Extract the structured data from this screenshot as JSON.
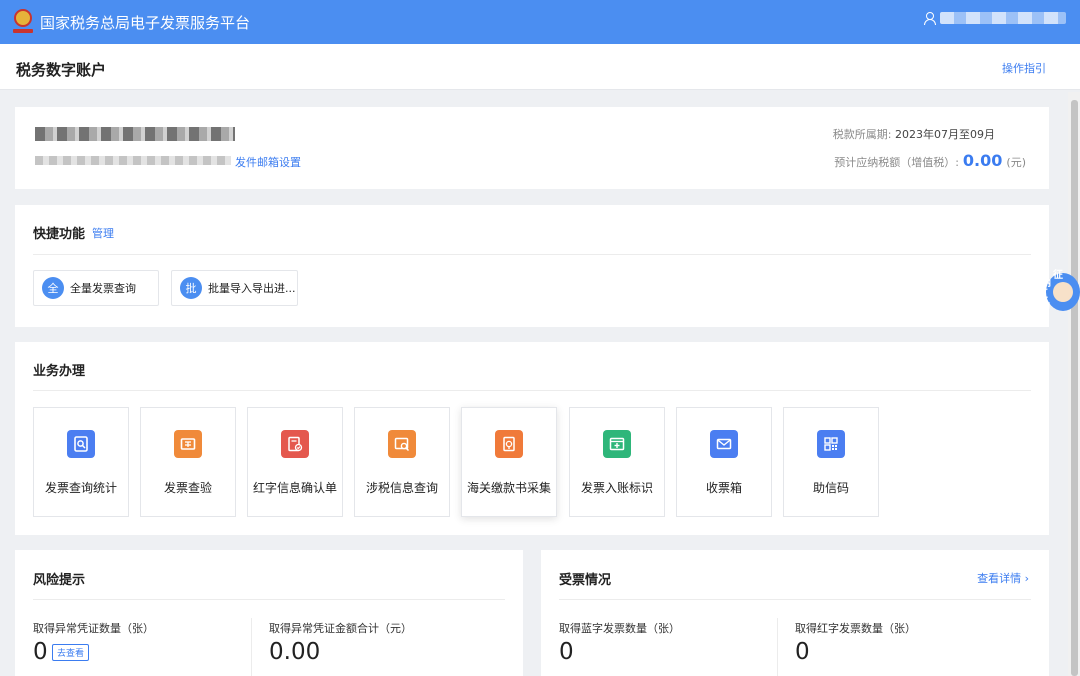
{
  "header": {
    "title": "国家税务总局电子发票服务平台"
  },
  "subheader": {
    "title": "税务数字账户",
    "help_link": "操作指引"
  },
  "account": {
    "email_settings": "发件邮箱设置",
    "period_label": "税款所属期:",
    "period_value": "2023年07月至09月",
    "tax_label": "预计应纳税额（增值税）:",
    "tax_amount": "0.00",
    "tax_unit": "(元)"
  },
  "quick": {
    "title": "快捷功能",
    "manage": "管理",
    "items": [
      {
        "glyph": "全",
        "label": "全量发票查询"
      },
      {
        "glyph": "批",
        "label": "批量导入导出进..."
      }
    ]
  },
  "business": {
    "title": "业务办理",
    "tiles": [
      {
        "label": "发票查询统计",
        "icon": "invoice-search-icon",
        "color": "#4b7ef1"
      },
      {
        "label": "发票查验",
        "icon": "ticket-check-icon",
        "color": "#f08a3a"
      },
      {
        "label": "红字信息确认单",
        "icon": "red-form-confirm-icon",
        "color": "#e4584e"
      },
      {
        "label": "涉税信息查询",
        "icon": "tax-info-search-icon",
        "color": "#f08a3a"
      },
      {
        "label": "海关缴款书采集",
        "icon": "customs-payment-icon",
        "color": "#f07a3a"
      },
      {
        "label": "发票入账标识",
        "icon": "invoice-ledger-icon",
        "color": "#2eb67a"
      },
      {
        "label": "收票箱",
        "icon": "mailbox-icon",
        "color": "#4b7ef1"
      },
      {
        "label": "助信码",
        "icon": "qr-code-icon",
        "color": "#4b7ef1"
      }
    ]
  },
  "risk": {
    "title": "风险提示",
    "stat1_label": "取得异常凭证数量（张）",
    "stat1_value": "0",
    "view_button": "去查看",
    "stat2_label": "取得异常凭证金额合计（元）",
    "stat2_value": "0.00"
  },
  "invoices": {
    "title": "受票情况",
    "detail_link": "查看详情",
    "stat1_label": "取得蓝字发票数量（张）",
    "stat1_value": "0",
    "stat2_label": "取得红字发票数量（张）",
    "stat2_value": "0"
  },
  "float_widget": {
    "chars": [
      "纳",
      "互",
      "动",
      "征"
    ]
  }
}
